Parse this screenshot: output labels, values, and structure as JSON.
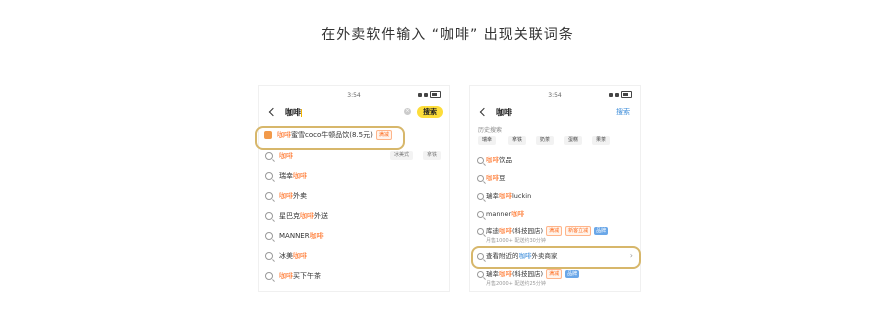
{
  "title": "在外卖软件输入 “咖啡” 出现关联词条",
  "left_phone": {
    "status_time": "3:54",
    "query": "咖啡",
    "search_button": "搜索",
    "brand_suggestion": {
      "hl": "咖啡",
      "rest": "蜜雪coco牛顿品饮(8.5元)",
      "tag": "满减"
    },
    "rows": [
      {
        "pre": "",
        "hl": "咖啡",
        "post": "",
        "chips": [
          "冰美式",
          "拿铁"
        ]
      },
      {
        "pre": "瑞幸",
        "hl": "咖啡",
        "post": ""
      },
      {
        "pre": "",
        "hl": "咖啡",
        "post": "外卖"
      },
      {
        "pre": "星巴克",
        "hl": "咖啡",
        "post": "外送"
      },
      {
        "pre": "MANNER",
        "hl": "咖啡",
        "post": ""
      },
      {
        "pre": "冰美",
        "hl": "咖啡",
        "post": ""
      },
      {
        "pre": "",
        "hl": "咖啡",
        "post": "买下午茶"
      }
    ]
  },
  "right_phone": {
    "status_time": "3:54",
    "query": "咖啡",
    "search_button": "搜索",
    "history_label": "历史搜索",
    "history_chips": [
      "瑞幸",
      "拿铁",
      "奶茶",
      "蛋糕",
      "果茶"
    ],
    "rows": [
      {
        "pre": "",
        "hl": "咖啡",
        "post": "饮品"
      },
      {
        "pre": "",
        "hl": "咖啡",
        "post": "豆"
      },
      {
        "pre": "瑞幸",
        "hl": "咖啡",
        "post": "luckin"
      },
      {
        "pre": "manner",
        "hl": "咖啡",
        "post": ""
      }
    ],
    "shop1": {
      "text": "库迪",
      "hl": "咖啡",
      "post": "(科技园店)",
      "tag1": "满减",
      "tag2": "新客立减",
      "tag3": "品牌",
      "sub": "月售1000+ 配送约30分钟"
    },
    "highlight_row": {
      "pre": "查看附近的",
      "hl": "咖啡",
      "post": "外卖商家"
    },
    "shop2": {
      "text": "瑞幸",
      "hl": "咖啡",
      "post": "(科技园店)",
      "tag1": "满减",
      "tag2": "品牌",
      "sub": "月售2000+ 配送约25分钟"
    }
  }
}
